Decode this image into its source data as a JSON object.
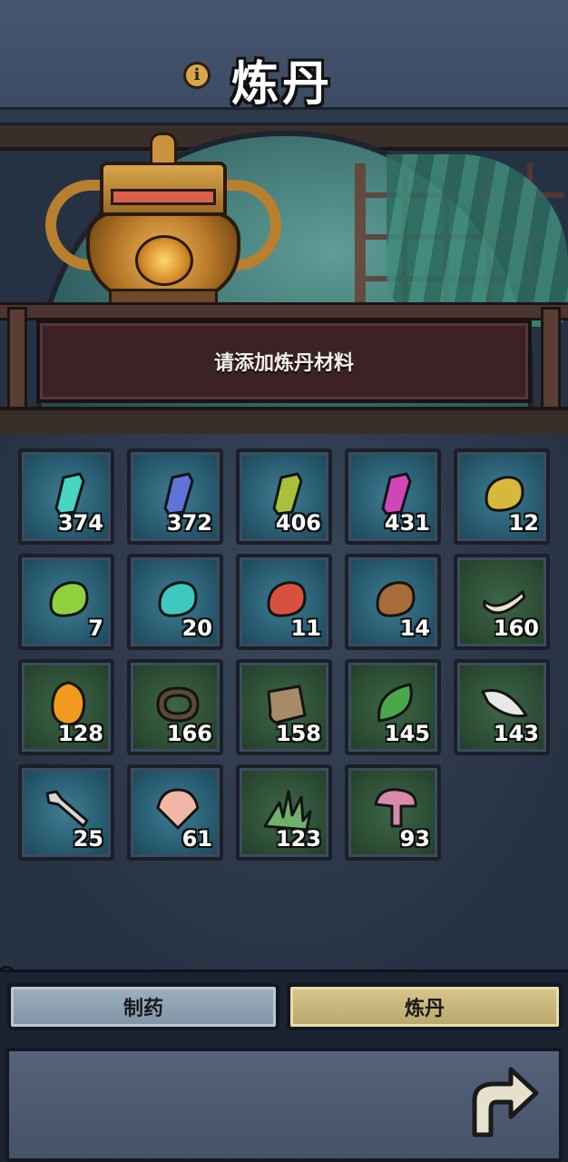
{
  "header": {
    "title": "炼丹",
    "info_icon": "info-icon"
  },
  "scene": {
    "status_text": "请添加炼丹材料"
  },
  "inventory": {
    "items": [
      {
        "name": "cyan-crystal",
        "count": "374",
        "bg": "blue",
        "color": "#46d6c2"
      },
      {
        "name": "blue-crystal",
        "count": "372",
        "bg": "blue",
        "color": "#5f73d8"
      },
      {
        "name": "olive-crystal",
        "count": "406",
        "bg": "blue",
        "color": "#a9c03a"
      },
      {
        "name": "magenta-crystal",
        "count": "431",
        "bg": "blue",
        "color": "#d046b8"
      },
      {
        "name": "yellow-stone",
        "count": "12",
        "bg": "blue",
        "color": "#d8b83a"
      },
      {
        "name": "green-stone",
        "count": "7",
        "bg": "blue",
        "color": "#8ed23f"
      },
      {
        "name": "teal-stone",
        "count": "20",
        "bg": "blue",
        "color": "#3fc8c0"
      },
      {
        "name": "red-stone",
        "count": "11",
        "bg": "blue",
        "color": "#d8513f"
      },
      {
        "name": "brown-stone",
        "count": "14",
        "bg": "blue",
        "color": "#a86b3a"
      },
      {
        "name": "horn",
        "count": "160",
        "bg": "green",
        "color": "#e8e2cf"
      },
      {
        "name": "amber-egg",
        "count": "128",
        "bg": "green",
        "color": "#f09a1e"
      },
      {
        "name": "rope-coil",
        "count": "166",
        "bg": "green",
        "color": "#5a4a34"
      },
      {
        "name": "parchment",
        "count": "158",
        "bg": "green",
        "color": "#a88a66"
      },
      {
        "name": "leaf",
        "count": "145",
        "bg": "green",
        "color": "#4aa84a"
      },
      {
        "name": "feather",
        "count": "143",
        "bg": "green",
        "color": "#e8e8e8"
      },
      {
        "name": "bone-branch",
        "count": "25",
        "bg": "blue",
        "color": "#d8d8d8"
      },
      {
        "name": "seashell",
        "count": "61",
        "bg": "blue",
        "color": "#f2b6a6"
      },
      {
        "name": "herb-grass",
        "count": "123",
        "bg": "green",
        "color": "#6fb06a"
      },
      {
        "name": "pink-mushroom",
        "count": "93",
        "bg": "green",
        "color": "#d88aa8"
      }
    ]
  },
  "tabs": {
    "left_label": "制药",
    "right_label": "炼丹"
  },
  "bottom": {
    "back_icon": "back-arrow-icon"
  }
}
